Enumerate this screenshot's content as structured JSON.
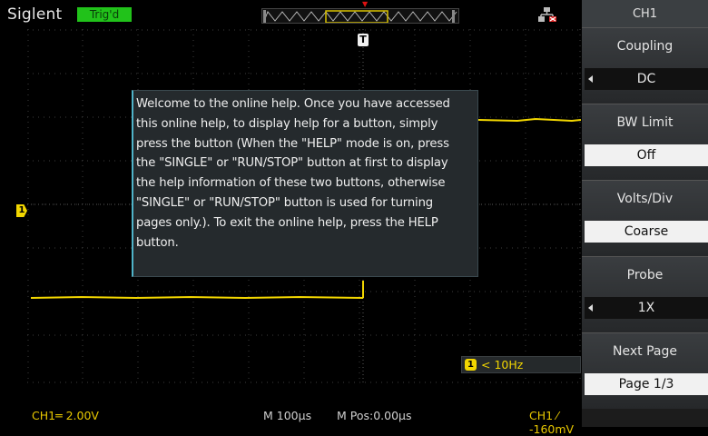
{
  "header": {
    "brand": "Siglent",
    "trigger_status": "Trig'd"
  },
  "help": {
    "lines": [
      "Welcome to the online help. Once you have accessed",
      "this online help, to display help for a button, simply",
      "press the button (When the \"HELP\" mode is on, press",
      "the \"SINGLE\" or \"RUN/STOP\" button at first to display",
      "the help information of these two buttons, otherwise",
      "\"SINGLE\" or \"RUN/STOP\" button is used for turning",
      "pages only.). To exit the online help, press the HELP",
      "button."
    ]
  },
  "markers": {
    "trigger_time": "T",
    "ch1_level": "1",
    "freq_icon": "1"
  },
  "readout": {
    "frequency": "< 10Hz"
  },
  "menu": {
    "title": "CH1",
    "items": [
      {
        "label": "Coupling",
        "value": "DC"
      },
      {
        "label": "BW Limit",
        "value": "Off"
      },
      {
        "label": "Volts/Div",
        "value": "Coarse"
      },
      {
        "label": "Probe",
        "value": "1X"
      },
      {
        "label": "Next Page",
        "value": "Page 1/3"
      }
    ]
  },
  "status": {
    "ch1_scale": "CH1═ 2.00V",
    "timebase": "M 100μs",
    "mpos": "M Pos:0.00μs",
    "trigger": "CH1 ⁄ -160mV"
  },
  "colors": {
    "ch1": "#f2d600",
    "trig_status_bg": "#21c21a",
    "help_border": "#4fb3c8",
    "menu_bg": "#3a3d40"
  },
  "icons": {
    "network": "lan-disconnected-icon",
    "arrow": "left-arrow-icon"
  }
}
